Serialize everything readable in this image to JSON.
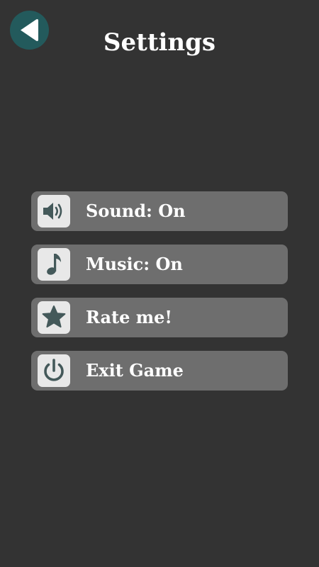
{
  "header": {
    "title": "Settings",
    "back_icon": "back-arrow-icon"
  },
  "colors": {
    "background": "#333333",
    "item_background": "#6e6e6e",
    "icon_tile": "#e8e8e8",
    "icon_glyph": "#44595a",
    "back_button": "#235a5c"
  },
  "menu": {
    "items": [
      {
        "label": "Sound: On",
        "icon": "speaker-icon"
      },
      {
        "label": "Music: On",
        "icon": "music-note-icon"
      },
      {
        "label": "Rate me!",
        "icon": "star-icon"
      },
      {
        "label": "Exit Game",
        "icon": "power-icon"
      }
    ]
  }
}
